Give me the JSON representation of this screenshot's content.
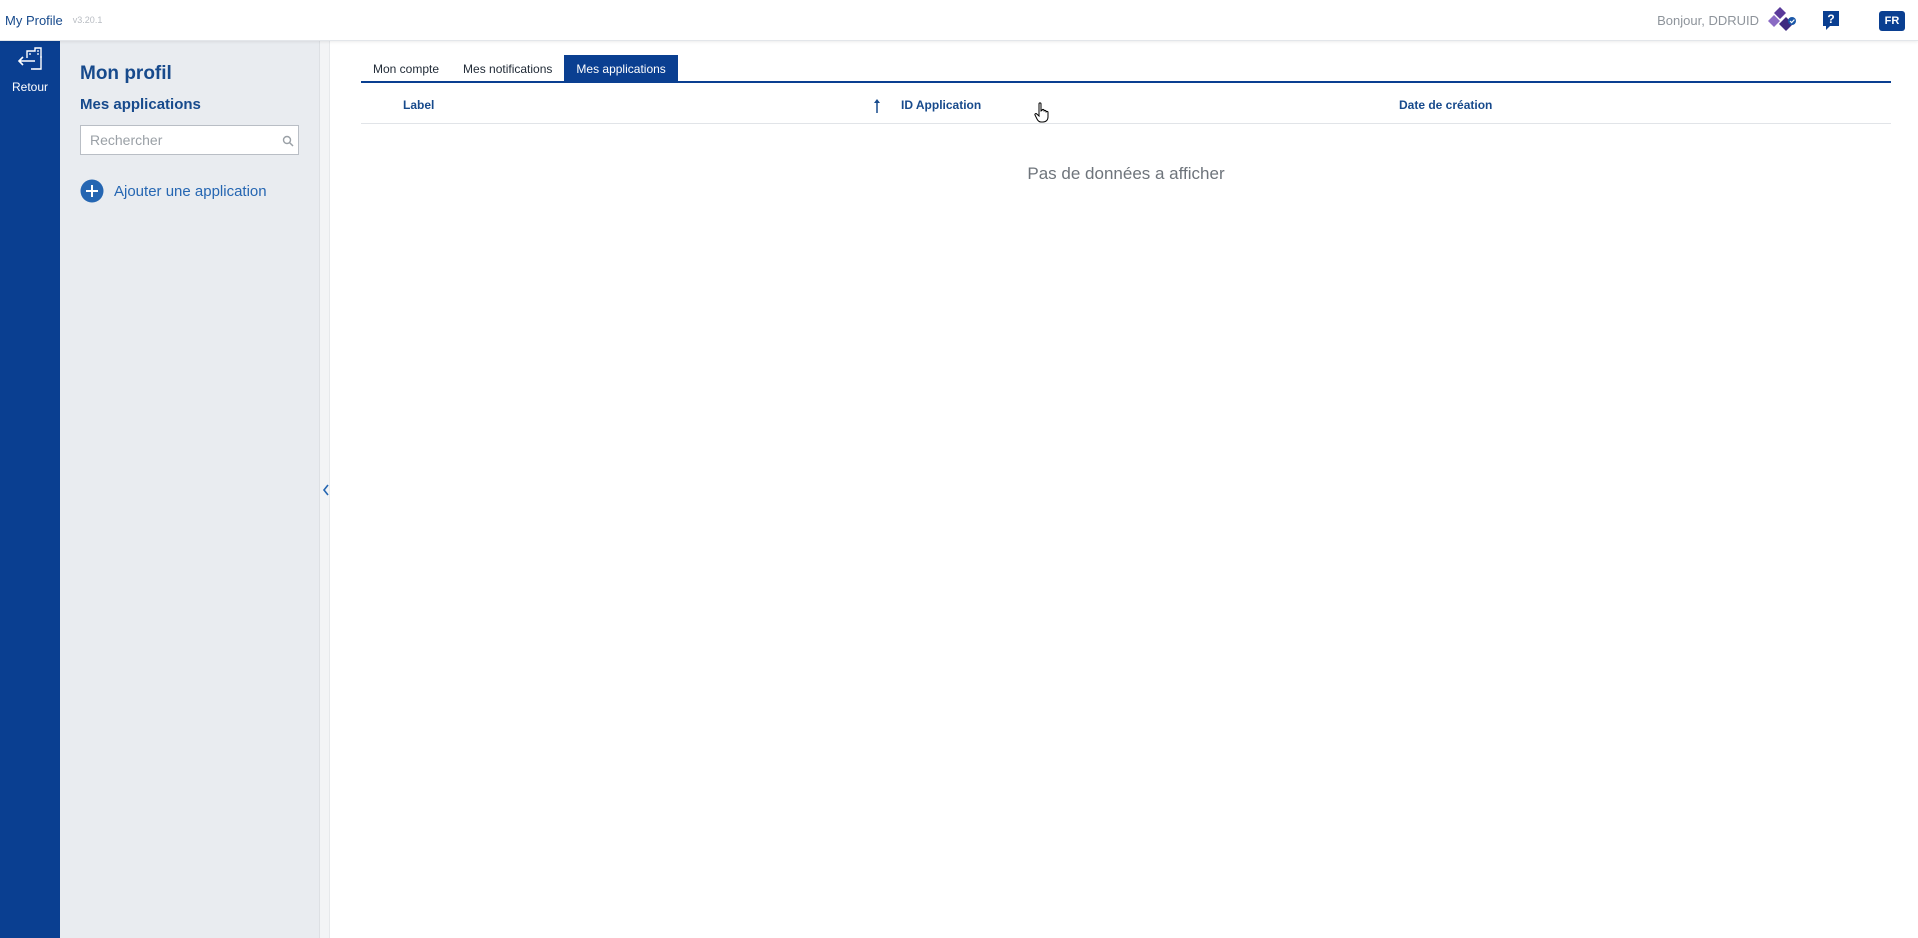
{
  "header": {
    "app_title": "My Profile",
    "version": "v3.20.1",
    "greeting": "Bonjour, DDRUID",
    "help_icon": "question-mark-icon",
    "language": "FR"
  },
  "rail": {
    "back_label": "Retour",
    "back_icon": "building-arrow-back-icon"
  },
  "sidebar": {
    "title": "Mon profil",
    "section": "Mes applications",
    "search_placeholder": "Rechercher",
    "add_label": "Ajouter une application"
  },
  "tabs": [
    {
      "label": "Mon compte",
      "active": false
    },
    {
      "label": "Mes notifications",
      "active": false
    },
    {
      "label": "Mes applications",
      "active": true
    }
  ],
  "table": {
    "columns": [
      "Label",
      "ID Application",
      "Date de création"
    ],
    "sort_column": "Label",
    "sort_direction": "ascending",
    "rows": [],
    "empty_message": "Pas de données a afficher"
  },
  "colors": {
    "primary": "#0a3f91",
    "sidebar_bg": "#e9ecf0",
    "text_blue": "#174a8c",
    "link_blue": "#2566b2",
    "logo_purple": "#6a3fa3"
  }
}
